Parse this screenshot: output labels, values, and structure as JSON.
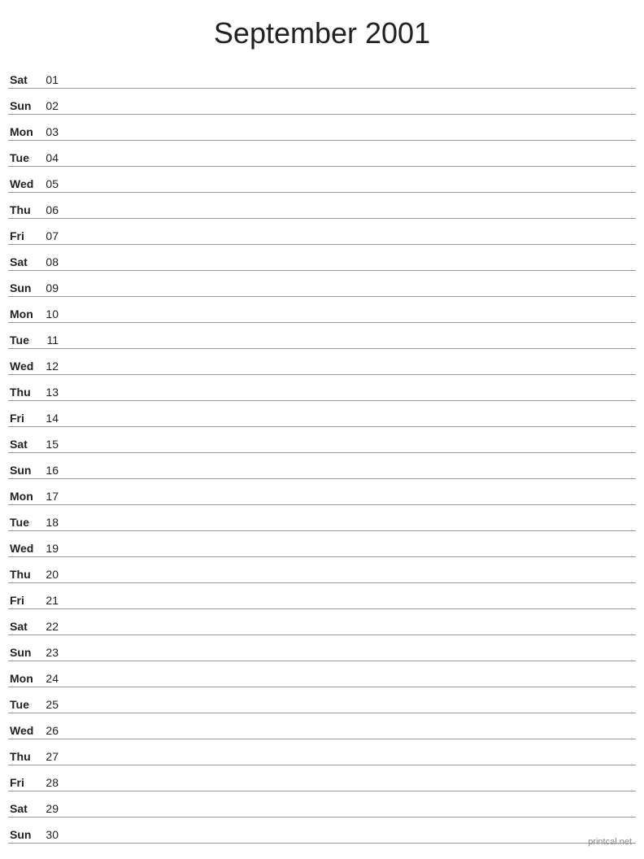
{
  "title": "September 2001",
  "footer": "printcal.net",
  "days": [
    {
      "name": "Sat",
      "number": "01"
    },
    {
      "name": "Sun",
      "number": "02"
    },
    {
      "name": "Mon",
      "number": "03"
    },
    {
      "name": "Tue",
      "number": "04"
    },
    {
      "name": "Wed",
      "number": "05"
    },
    {
      "name": "Thu",
      "number": "06"
    },
    {
      "name": "Fri",
      "number": "07"
    },
    {
      "name": "Sat",
      "number": "08"
    },
    {
      "name": "Sun",
      "number": "09"
    },
    {
      "name": "Mon",
      "number": "10"
    },
    {
      "name": "Tue",
      "number": "11"
    },
    {
      "name": "Wed",
      "number": "12"
    },
    {
      "name": "Thu",
      "number": "13"
    },
    {
      "name": "Fri",
      "number": "14"
    },
    {
      "name": "Sat",
      "number": "15"
    },
    {
      "name": "Sun",
      "number": "16"
    },
    {
      "name": "Mon",
      "number": "17"
    },
    {
      "name": "Tue",
      "number": "18"
    },
    {
      "name": "Wed",
      "number": "19"
    },
    {
      "name": "Thu",
      "number": "20"
    },
    {
      "name": "Fri",
      "number": "21"
    },
    {
      "name": "Sat",
      "number": "22"
    },
    {
      "name": "Sun",
      "number": "23"
    },
    {
      "name": "Mon",
      "number": "24"
    },
    {
      "name": "Tue",
      "number": "25"
    },
    {
      "name": "Wed",
      "number": "26"
    },
    {
      "name": "Thu",
      "number": "27"
    },
    {
      "name": "Fri",
      "number": "28"
    },
    {
      "name": "Sat",
      "number": "29"
    },
    {
      "name": "Sun",
      "number": "30"
    }
  ]
}
